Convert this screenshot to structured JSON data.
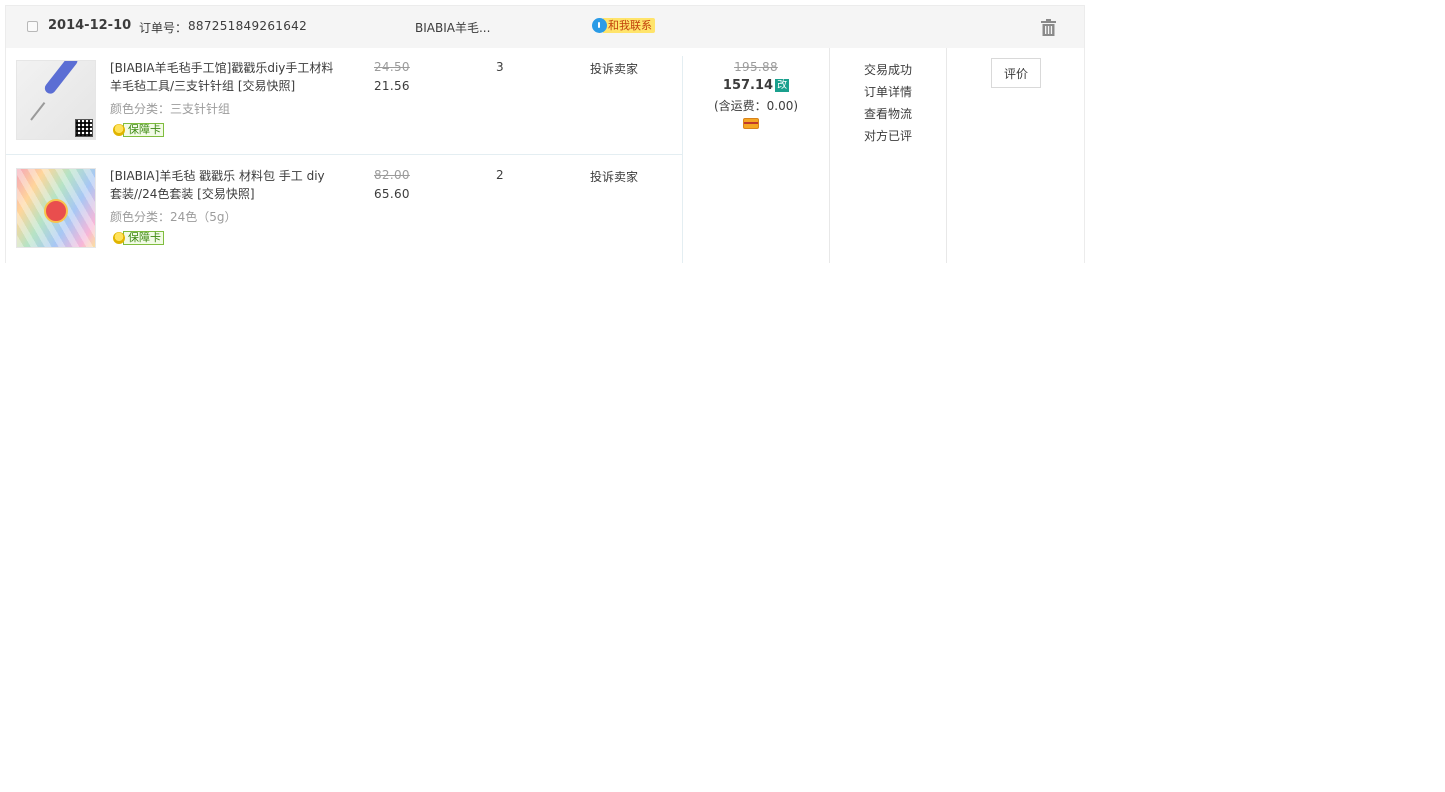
{
  "order": {
    "date": "2014-12-10",
    "order_no_label": "订单号：",
    "order_no": "887251849261642",
    "shop_name": "BIABIA羊毛...",
    "contact_label": "和我联系",
    "items": [
      {
        "title": "[BIABIA羊毛毡手工馆]戳戳乐diy手工材料羊毛毡工具/三支针针组 [交易快照]",
        "sku": "颜色分类：三支针针组",
        "badge": "保障卡",
        "price_original": "24.50",
        "price_now": "21.56",
        "qty": "3",
        "service": "投诉卖家"
      },
      {
        "title": "[BIABIA]羊毛毡 戳戳乐 材料包 手工 diy套装//24色套装 [交易快照]",
        "sku": "颜色分类：24色（5g）",
        "badge": "保障卡",
        "price_original": "82.00",
        "price_now": "65.60",
        "qty": "2",
        "service": "投诉卖家"
      }
    ],
    "total": {
      "original": "195.88",
      "now": "157.14",
      "modified_tag": "改",
      "shipping": "(含运费：0.00)"
    },
    "status": {
      "trade": "交易成功",
      "detail": "订单详情",
      "logistics": "查看物流",
      "rated": "对方已评"
    },
    "action": {
      "review": "评价"
    }
  },
  "colors": {
    "header_bg": "#f5f5f5",
    "contact_bg": "#ffe46b",
    "modified_tag_bg": "#1aa08d",
    "badge_green": "#3e8a13"
  },
  "icons": {
    "contact": "wangwang-chat-icon",
    "delete": "trash-icon",
    "badge": "guarantee-card-icon",
    "payment": "credit-card-icon"
  }
}
